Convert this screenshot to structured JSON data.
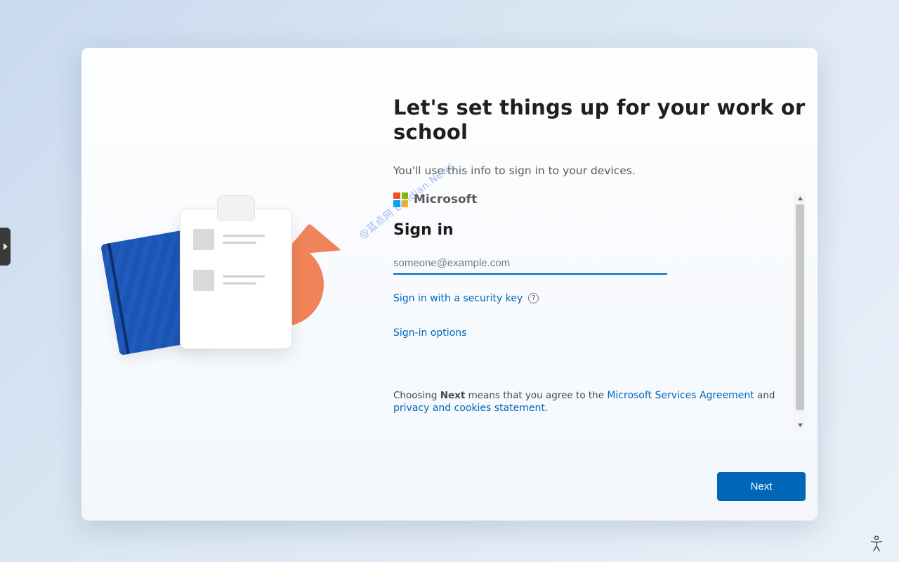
{
  "header": {
    "title": "Let's set things up for your work or school",
    "subtitle": "You'll use this info to sign in to your devices."
  },
  "brand": {
    "name": "Microsoft"
  },
  "signin": {
    "heading": "Sign in",
    "email_placeholder": "someone@example.com",
    "security_key_link": "Sign in with a security key",
    "options_link": "Sign-in options"
  },
  "agreement": {
    "pre": "Choosing ",
    "bold": "Next",
    "mid": " means that you agree to the ",
    "link1": "Microsoft Services Agreement",
    "and": " and ",
    "link2": "privacy and cookies statement",
    "suffix": "."
  },
  "buttons": {
    "next": "Next"
  },
  "watermark": "@蓝点网 Landian.News"
}
